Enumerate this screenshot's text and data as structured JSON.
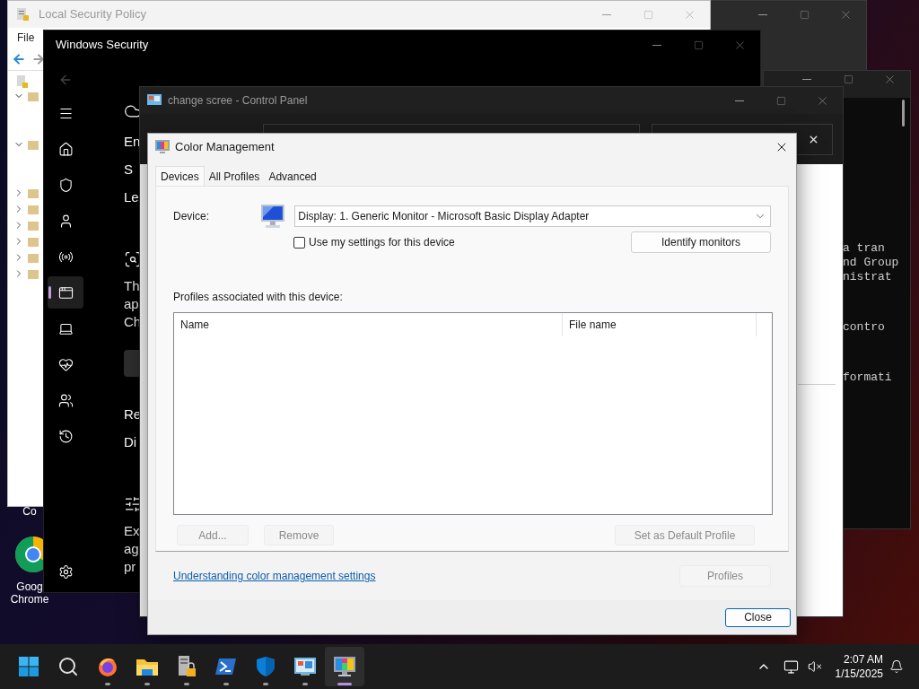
{
  "desktop_icons": [
    {
      "lines": [
        "Co"
      ]
    },
    {
      "kind": "chrome",
      "lines": [
        "Goog",
        "Chrome"
      ]
    }
  ],
  "terminal": {
    "paragraphs": [
      [
        "a tran",
        "nd Group",
        "nistrat"
      ],
      [
        "contro"
      ],
      [
        "formati"
      ]
    ]
  },
  "local_security_policy": {
    "title": "Local Security Policy",
    "menu": [
      "File"
    ],
    "tree": [
      {
        "expanded": true
      },
      {
        "expanded": true
      },
      {
        "expanded": false
      },
      {
        "expanded": false
      },
      {
        "expanded": false
      },
      {
        "expanded": false
      },
      {
        "expanded": false
      },
      {
        "expanded": false
      }
    ]
  },
  "windows_security": {
    "title": "Windows Security",
    "nav": [
      {
        "kind": "menu",
        "selected": false
      },
      {
        "kind": "home",
        "selected": false
      },
      {
        "kind": "shield",
        "selected": false
      },
      {
        "kind": "account",
        "selected": false
      },
      {
        "kind": "network",
        "selected": false
      },
      {
        "kind": "app",
        "selected": true
      },
      {
        "kind": "device",
        "selected": false
      },
      {
        "kind": "health",
        "selected": false
      },
      {
        "kind": "family",
        "selected": false
      },
      {
        "kind": "history",
        "selected": false
      }
    ],
    "settings_nav": {
      "kind": "settings",
      "selected": false
    },
    "blocks": [
      {
        "kind": "icon"
      },
      {
        "kind": "links",
        "lines": [
          "En",
          "S",
          "Le"
        ]
      },
      {
        "kind": "icon"
      },
      {
        "kind": "paragraph",
        "lines": [
          "Th",
          "ap",
          "Ch"
        ]
      },
      {
        "kind": "button"
      },
      {
        "kind": "links",
        "lines": [
          "Re",
          "Di"
        ]
      },
      {
        "kind": "icon"
      },
      {
        "kind": "paragraph",
        "lines": [
          "Ex",
          "ag",
          "pr"
        ]
      }
    ]
  },
  "control_panel": {
    "title": "change scree - Control Panel"
  },
  "color_management": {
    "title": "Color Management",
    "tabs": [
      {
        "label": "Devices",
        "selected": true
      },
      {
        "label": "All Profiles",
        "selected": false
      },
      {
        "label": "Advanced",
        "selected": false
      }
    ],
    "device_label": "Device:",
    "device_value": "Display: 1. Generic Monitor - Microsoft Basic Display Adapter",
    "use_my_settings": {
      "label": "Use my settings for this device",
      "checked": false
    },
    "identify_button": "Identify monitors",
    "profiles_label": "Profiles associated with this device:",
    "columns": [
      "Name",
      "File name"
    ],
    "list_buttons": [
      {
        "label": "Add...",
        "disabled": true
      },
      {
        "label": "Remove",
        "disabled": true
      },
      {
        "label": "Set as Default Profile",
        "disabled": true
      }
    ],
    "link": "Understanding color management settings",
    "profiles_button": {
      "label": "Profiles",
      "disabled": true
    },
    "close_button": "Close"
  },
  "taskbar": {
    "apps": [
      {
        "kind": "start",
        "running": false,
        "selected": false
      },
      {
        "kind": "search",
        "running": false,
        "selected": false
      },
      {
        "kind": "firefox",
        "running": true,
        "selected": false
      },
      {
        "kind": "explorer",
        "running": true,
        "selected": false
      },
      {
        "kind": "secpol",
        "running": true,
        "selected": false
      },
      {
        "kind": "powershell",
        "running": true,
        "selected": false
      },
      {
        "kind": "defender",
        "running": true,
        "selected": false
      },
      {
        "kind": "controlpanel",
        "running": true,
        "selected": false
      },
      {
        "kind": "colormanagement",
        "running": true,
        "selected": true
      }
    ],
    "time": "2:07 AM",
    "date": "1/15/2025"
  }
}
